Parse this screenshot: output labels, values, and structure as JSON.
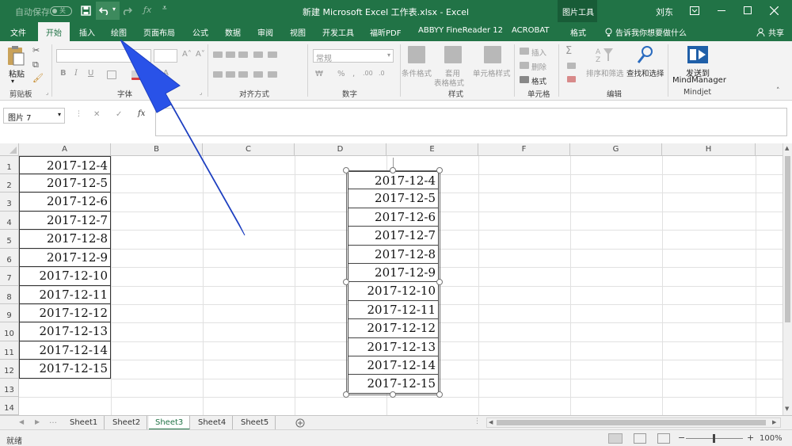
{
  "titlebar": {
    "autosave_label": "自动保存",
    "autosave_state": "关",
    "title": "新建 Microsoft Excel 工作表.xlsx  -  Excel",
    "contextual_group": "图片工具",
    "user": "刘东",
    "icons": [
      "save-icon",
      "undo-icon",
      "redo-icon",
      "fx-icon",
      "customize-icon",
      "ribbon-display-icon",
      "minimize-icon",
      "maximize-icon",
      "close-icon"
    ]
  },
  "tabs": [
    "文件",
    "开始",
    "插入",
    "绘图",
    "页面布局",
    "公式",
    "数据",
    "审阅",
    "视图",
    "开发工具",
    "福昕PDF",
    "ABBYY FineReader 12",
    "ACROBAT",
    "格式"
  ],
  "active_tab": "开始",
  "tell_me": "告诉我你想要做什么",
  "share": "共享",
  "ribbon": {
    "clipboard": {
      "paste": "粘贴",
      "label": "剪贴板"
    },
    "font": {
      "bold": "B",
      "italic": "I",
      "underline": "U",
      "label": "字体"
    },
    "alignment": {
      "label": "对齐方式"
    },
    "number": {
      "format": "常规",
      "label": "数字"
    },
    "styles": {
      "cond_format": "条件格式",
      "table_format_1": "套用",
      "table_format_2": "表格格式",
      "cell_styles": "单元格样式",
      "label": "样式"
    },
    "cells": {
      "insert": "插入",
      "delete": "删除",
      "format": "格式",
      "label": "单元格"
    },
    "editing": {
      "sort": "排序和筛选",
      "find": "查找和选择",
      "label": "编辑"
    },
    "mindjet": {
      "send_1": "发送到",
      "send_2": "MindManager",
      "label": "Mindjet"
    }
  },
  "formula_bar": {
    "name_box": "图片 7",
    "cancel": "✕",
    "enter": "✓",
    "fx": "fx"
  },
  "grid": {
    "columns": [
      "A",
      "B",
      "C",
      "D",
      "E",
      "F",
      "G",
      "H"
    ],
    "rows": [
      "1",
      "2",
      "3",
      "4",
      "5",
      "6",
      "7",
      "8",
      "9",
      "10",
      "11",
      "12",
      "13",
      "14"
    ],
    "cells_A": [
      "2017-12-4",
      "2017-12-5",
      "2017-12-6",
      "2017-12-7",
      "2017-12-8",
      "2017-12-9",
      "2017-12-10",
      "2017-12-11",
      "2017-12-12",
      "2017-12-13",
      "2017-12-14",
      "2017-12-15"
    ],
    "picture_cells": [
      "2017-12-4",
      "2017-12-5",
      "2017-12-6",
      "2017-12-7",
      "2017-12-8",
      "2017-12-9",
      "2017-12-10",
      "2017-12-11",
      "2017-12-12",
      "2017-12-13",
      "2017-12-14",
      "2017-12-15"
    ]
  },
  "sheets": [
    "Sheet1",
    "Sheet2",
    "Sheet3",
    "Sheet4",
    "Sheet5"
  ],
  "active_sheet": "Sheet3",
  "status": {
    "ready": "就绪",
    "zoom": "100%"
  },
  "colors": {
    "accent": "#217346",
    "arrow": "#2952e8"
  }
}
